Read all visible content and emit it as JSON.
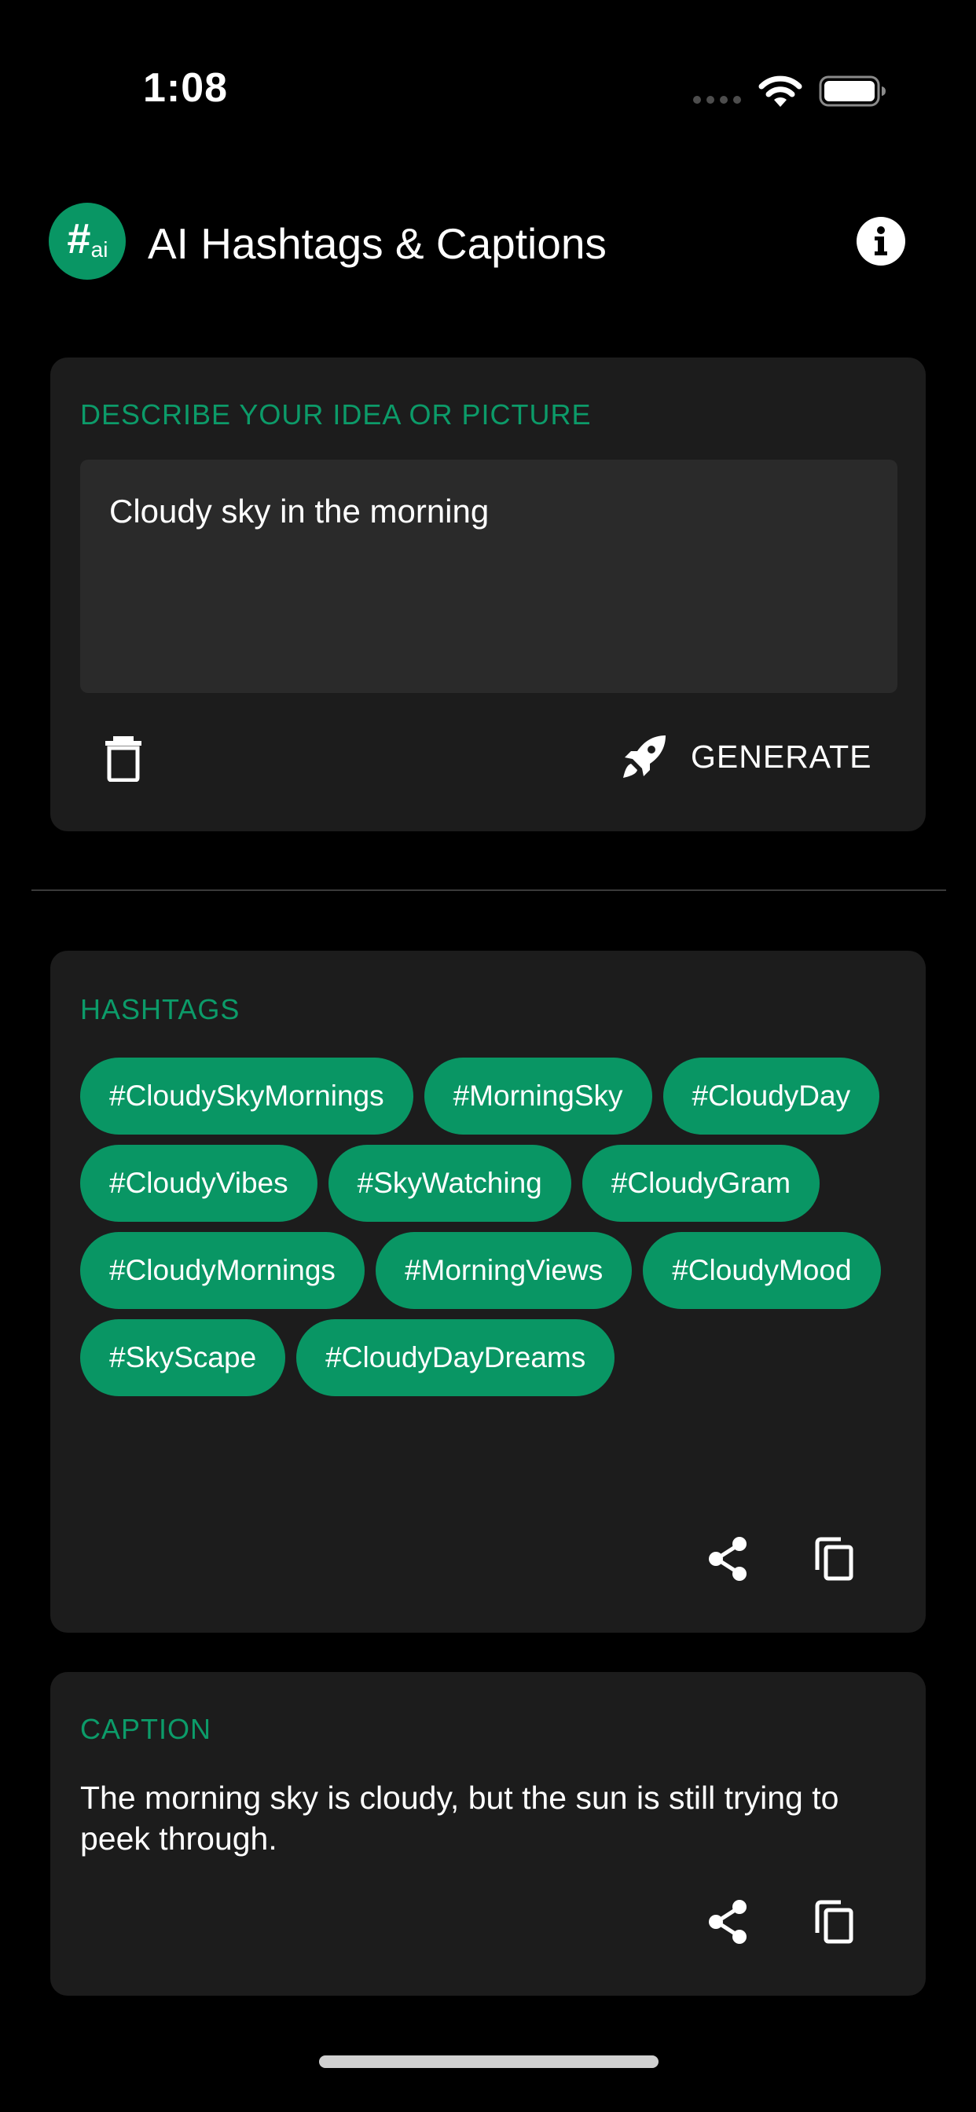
{
  "status_bar": {
    "time": "1:08"
  },
  "header": {
    "logo_hash": "#",
    "logo_suffix": "ai",
    "title": "AI Hashtags & Captions",
    "info_icon": "info-circle-icon"
  },
  "input_card": {
    "label": "DESCRIBE YOUR IDEA OR PICTURE",
    "input_value": "Cloudy sky in the morning",
    "delete_icon": "trash-icon",
    "generate_icon": "rocket-icon",
    "generate_label": "GENERATE"
  },
  "hashtags_card": {
    "label": "HASHTAGS",
    "tags": [
      "#CloudySkyMornings",
      "#MorningSky",
      "#CloudyDay",
      "#CloudyVibes",
      "#SkyWatching",
      "#CloudyGram",
      "#CloudyMornings",
      "#MorningViews",
      "#CloudyMood",
      "#SkyScape",
      "#CloudyDayDreams"
    ],
    "share_icon": "share-icon",
    "copy_icon": "copy-icon"
  },
  "caption_card": {
    "label": "CAPTION",
    "text": "The morning sky is cloudy, but the sun is still trying to peek through.",
    "share_icon": "share-icon",
    "copy_icon": "copy-icon"
  },
  "colors": {
    "background": "#000000",
    "card": "#1c1c1c",
    "input": "#2a2a2a",
    "accent": "#099664",
    "label": "#0c9b69"
  }
}
